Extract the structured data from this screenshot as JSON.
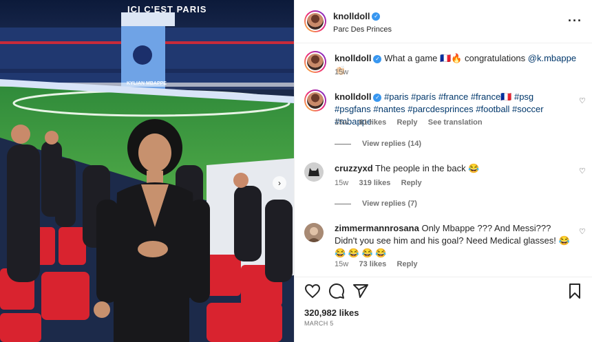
{
  "post": {
    "username": "knolldoll",
    "location": "Parc Des Princes",
    "likes": "320,982 likes",
    "date": "MARCH 5"
  },
  "media": {
    "banner_text": "ICI C'EST PARIS",
    "player_name_on_banner": "KYLIAN MBAPPE"
  },
  "caption": {
    "username": "knolldoll",
    "text": "What a game 🇫🇷🔥 congratulations",
    "mention": "@k.mbappe",
    "emoji_end": "👏🏻",
    "time": "15w"
  },
  "comments": [
    {
      "username": "knolldoll",
      "text": "#paris #parís #france #france🇫🇷 #psg #psgfans #nantes #parcdesprinces #football #soccer #mbappe",
      "time": "15w",
      "likes": "61 likes",
      "reply": "Reply",
      "translate": "See translation",
      "view_replies": "View replies (14)"
    },
    {
      "username": "cruzzyxd",
      "text": "The people in the back 😂",
      "time": "15w",
      "likes": "319 likes",
      "reply": "Reply",
      "view_replies": "View replies (7)"
    },
    {
      "username": "zimmermannrosana",
      "text": "Only Mbappe ??? And Messi??? Didn't you see him and his goal? Need Medical glasses! 😂 😂 😂 😂 😂",
      "time": "15w",
      "likes": "73 likes",
      "reply": "Reply"
    }
  ],
  "icons": [
    "more-icon",
    "heart-icon",
    "comment-icon",
    "share-icon",
    "bookmark-icon",
    "verified-icon",
    "carousel-next-icon"
  ]
}
